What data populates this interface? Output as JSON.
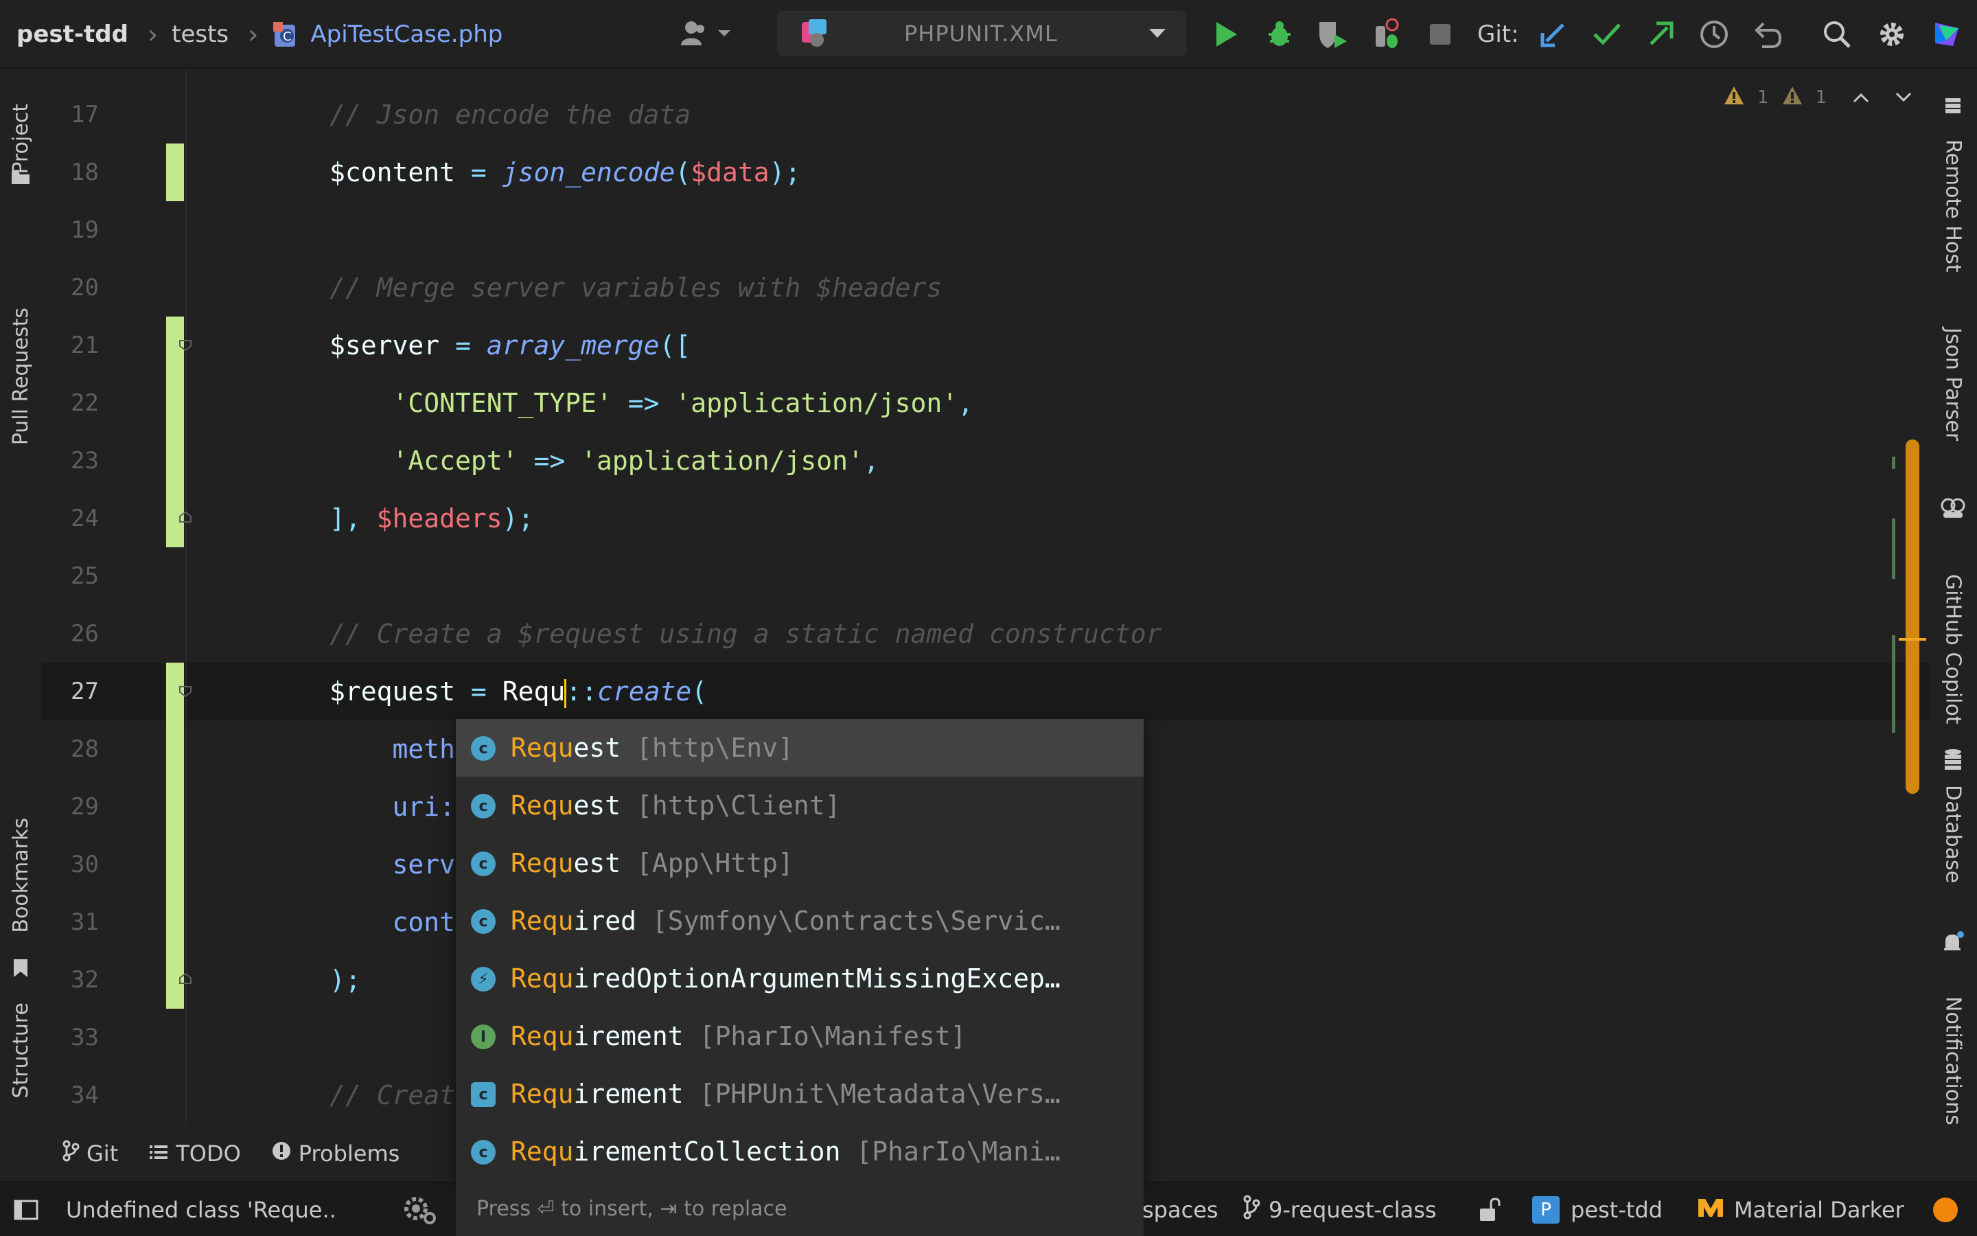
{
  "breadcrumb": {
    "project": "pest-tdd",
    "folder": "tests",
    "file": "ApiTestCase.php"
  },
  "run_config": {
    "label": "PHPUNIT.XML"
  },
  "git": {
    "label": "Git:"
  },
  "left_tools": {
    "project": "Project",
    "pull_requests": "Pull Requests",
    "bookmarks": "Bookmarks",
    "structure": "Structure"
  },
  "right_tools": {
    "remote_host": "Remote Host",
    "json_parser": "Json Parser",
    "copilot": "GitHub Copilot",
    "database": "Database",
    "notifications": "Notifications"
  },
  "inspections": {
    "warnings": "1",
    "weak_warnings": "1"
  },
  "editor": {
    "lines": [
      {
        "num": "17",
        "code": "// Json encode the data"
      },
      {
        "num": "18",
        "code": "$content = json_encode($data);"
      },
      {
        "num": "19",
        "code": ""
      },
      {
        "num": "20",
        "code": "// Merge server variables with $headers"
      },
      {
        "num": "21",
        "code": "$server = array_merge(["
      },
      {
        "num": "22",
        "code": "    'CONTENT_TYPE' => 'application/json',"
      },
      {
        "num": "23",
        "code": "    'Accept' => 'application/json',"
      },
      {
        "num": "24",
        "code": "], $headers);"
      },
      {
        "num": "25",
        "code": ""
      },
      {
        "num": "26",
        "code": "// Create a $request using a static named constructor"
      },
      {
        "num": "27",
        "code": "$request = Requ::create("
      },
      {
        "num": "28",
        "code": "    meth"
      },
      {
        "num": "29",
        "code": "    uri:"
      },
      {
        "num": "30",
        "code": "    serv"
      },
      {
        "num": "31",
        "code": "    cont"
      },
      {
        "num": "32",
        "code": ");"
      },
      {
        "num": "33",
        "code": ""
      },
      {
        "num": "34",
        "code": "// Creat"
      }
    ]
  },
  "completion": {
    "typed": "Requ",
    "items": [
      {
        "rest": "est",
        "location": "[http\\Env]",
        "kind": "class"
      },
      {
        "rest": "est",
        "location": "[http\\Client]",
        "kind": "class"
      },
      {
        "rest": "est",
        "location": "[App\\Http]",
        "kind": "class"
      },
      {
        "rest": "ired",
        "location": "[Symfony\\Contracts\\Servic…",
        "kind": "attribute"
      },
      {
        "rest": "iredOptionArgumentMissingExcep…",
        "location": "",
        "kind": "exception"
      },
      {
        "rest": "irement",
        "location": "[PharIo\\Manifest]",
        "kind": "interface"
      },
      {
        "rest": "irement",
        "location": "[PHPUnit\\Metadata\\Vers…",
        "kind": "abstract"
      },
      {
        "rest": "irementCollection",
        "location": "[PharIo\\Mani…",
        "kind": "class"
      }
    ],
    "hint": "Press ⏎ to insert, ⇥ to replace"
  },
  "bottom_tabs": {
    "git": "Git",
    "todo": "TODO",
    "problems": "Problems"
  },
  "status": {
    "message": "Undefined class 'Reque..",
    "workspace": "spaces",
    "branch": "9-request-class",
    "project": "pest-tdd",
    "theme": "Material Darker"
  },
  "colors": {
    "accent": "#f5a623",
    "added": "#c3e88d",
    "string": "#c3e88d",
    "function": "#82aaff",
    "variable_ref": "#f07178",
    "comment": "#545454"
  }
}
